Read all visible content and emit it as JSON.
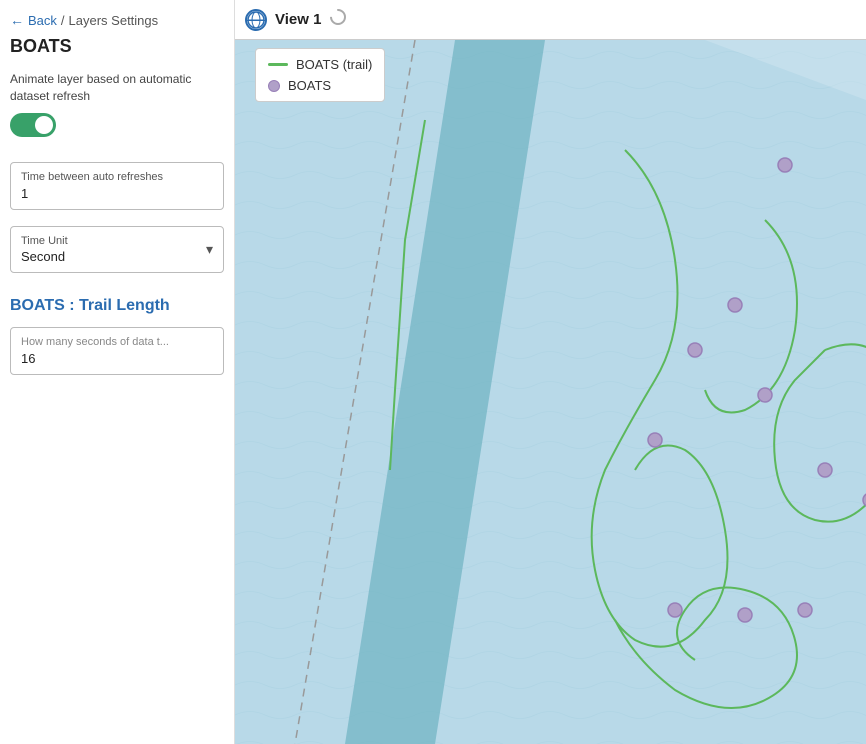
{
  "breadcrumb": {
    "back_label": "Back",
    "separator": "/",
    "layer_label": "Layers Settings"
  },
  "panel": {
    "title": "BOATS",
    "animate_label": "Animate layer based on automatic dataset refresh",
    "toggle_on": true,
    "time_refresh_field": {
      "label": "Time between auto refreshes",
      "value": "1"
    },
    "time_unit_field": {
      "label": "Time Unit",
      "value": "Second"
    },
    "trail_section_title": "BOATS : Trail Length",
    "trail_data_field": {
      "label": "How many seconds of data t...",
      "value": "16"
    }
  },
  "map": {
    "view_title": "View 1",
    "legend": {
      "items": [
        {
          "type": "line",
          "label": "BOATS (trail)"
        },
        {
          "type": "circle",
          "label": "BOATS"
        }
      ]
    }
  },
  "icons": {
    "back_arrow": "←",
    "chevron_down": "▾",
    "loading": "◌"
  }
}
